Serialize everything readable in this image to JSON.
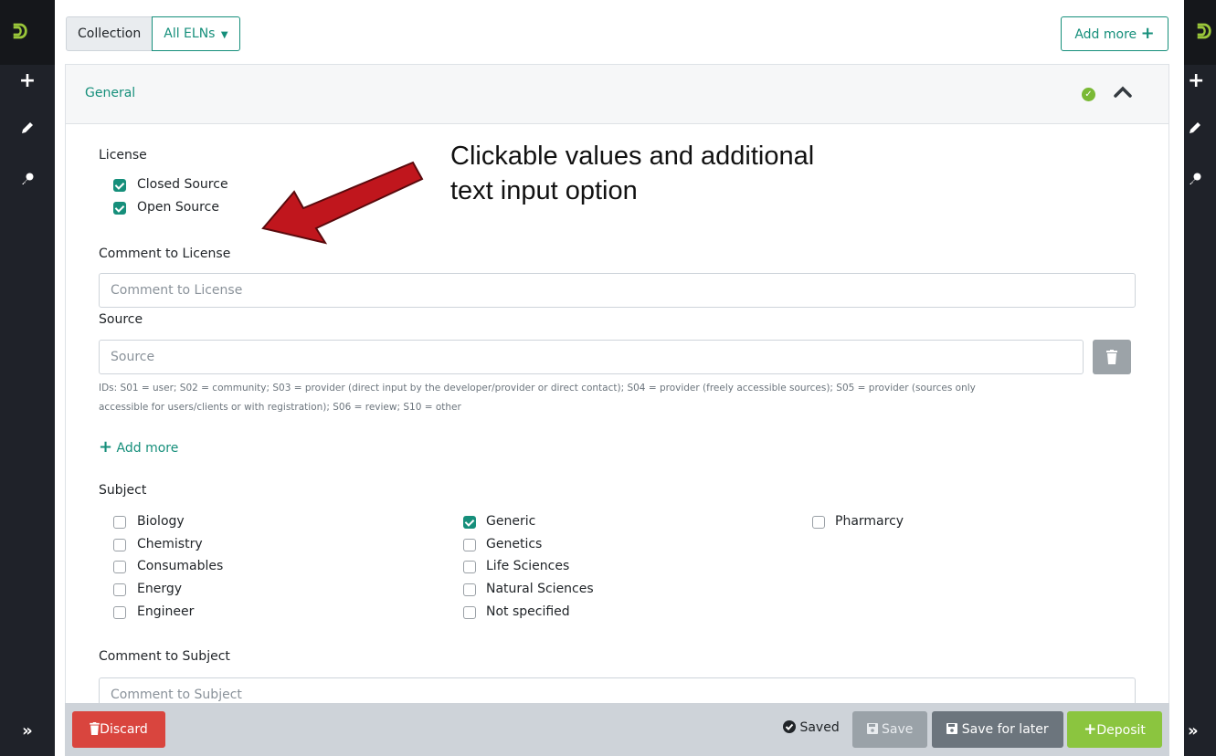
{
  "topbar": {
    "collection_label": "Collection",
    "eln_label": "All ELNs",
    "add_more_label": "Add more"
  },
  "panel": {
    "title": "General"
  },
  "license": {
    "label": "License",
    "options": [
      {
        "label": "Closed Source",
        "checked": true
      },
      {
        "label": "Open Source",
        "checked": true
      }
    ]
  },
  "comment_license": {
    "label": "Comment to License",
    "placeholder": "Comment to License"
  },
  "source": {
    "label": "Source",
    "placeholder": "Source",
    "help_line1": "IDs: S01 = user; S02 = community; S03 = provider (direct input by the developer/provider or direct contact); S04 = provider (freely accessible sources); S05 = provider (sources only",
    "help_line2": "accessible for users/clients or with registration); S06 = review; S10 = other",
    "add_more_label": "Add more"
  },
  "subject": {
    "label": "Subject",
    "col1": [
      {
        "label": "Biology",
        "checked": false
      },
      {
        "label": "Chemistry",
        "checked": false
      },
      {
        "label": "Consumables",
        "checked": false
      },
      {
        "label": "Energy",
        "checked": false
      },
      {
        "label": "Engineer",
        "checked": false
      }
    ],
    "col2": [
      {
        "label": "Generic",
        "checked": true
      },
      {
        "label": "Genetics",
        "checked": false
      },
      {
        "label": "Life Sciences",
        "checked": false
      },
      {
        "label": "Natural Sciences",
        "checked": false
      },
      {
        "label": "Not specified",
        "checked": false
      }
    ],
    "col3": [
      {
        "label": "Pharmarcy",
        "checked": false
      }
    ]
  },
  "comment_subject": {
    "label": "Comment to Subject",
    "placeholder": "Comment to Subject"
  },
  "annotation": {
    "line1": "Clickable values and additional",
    "line2": "text input option"
  },
  "footer": {
    "discard_label": "Discard",
    "saved_label": "Saved",
    "save_label": "Save",
    "save_later_label": "Save for later",
    "deposit_label": "Deposit"
  },
  "colors": {
    "accent": "#168f7b",
    "danger": "#d9453e",
    "success": "#8bc53f",
    "sidebar": "#1f2229",
    "arrow": "#c0161d"
  }
}
